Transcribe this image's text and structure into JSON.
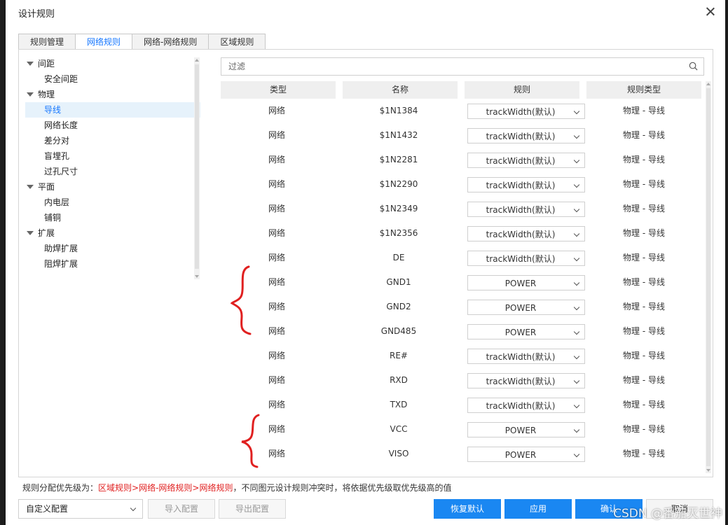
{
  "window": {
    "title": "设计规则"
  },
  "tabs": [
    {
      "label": "规则管理",
      "active": false
    },
    {
      "label": "网络规则",
      "active": true
    },
    {
      "label": "网络-网络规则",
      "active": false
    },
    {
      "label": "区域规则",
      "active": false
    }
  ],
  "tree": [
    {
      "label": "间距",
      "level": 1,
      "expanded": true
    },
    {
      "label": "安全间距",
      "level": 2
    },
    {
      "label": "物理",
      "level": 1,
      "expanded": true
    },
    {
      "label": "导线",
      "level": 2,
      "selected": true
    },
    {
      "label": "网络长度",
      "level": 2
    },
    {
      "label": "差分对",
      "level": 2
    },
    {
      "label": "盲埋孔",
      "level": 2
    },
    {
      "label": "过孔尺寸",
      "level": 2
    },
    {
      "label": "平面",
      "level": 1,
      "expanded": true
    },
    {
      "label": "内电层",
      "level": 2
    },
    {
      "label": "铺铜",
      "level": 2
    },
    {
      "label": "扩展",
      "level": 1,
      "expanded": true
    },
    {
      "label": "助焊扩展",
      "level": 2
    },
    {
      "label": "阻焊扩展",
      "level": 2
    }
  ],
  "filter": {
    "placeholder": "过滤"
  },
  "table": {
    "headers": [
      "类型",
      "名称",
      "规则",
      "规则类型"
    ],
    "rows": [
      {
        "type": "网络",
        "name": "$1N1384",
        "rule": "trackWidth(默认)",
        "rule_type": "物理 - 导线"
      },
      {
        "type": "网络",
        "name": "$1N1432",
        "rule": "trackWidth(默认)",
        "rule_type": "物理 - 导线"
      },
      {
        "type": "网络",
        "name": "$1N2281",
        "rule": "trackWidth(默认)",
        "rule_type": "物理 - 导线"
      },
      {
        "type": "网络",
        "name": "$1N2290",
        "rule": "trackWidth(默认)",
        "rule_type": "物理 - 导线"
      },
      {
        "type": "网络",
        "name": "$1N2349",
        "rule": "trackWidth(默认)",
        "rule_type": "物理 - 导线"
      },
      {
        "type": "网络",
        "name": "$1N2356",
        "rule": "trackWidth(默认)",
        "rule_type": "物理 - 导线"
      },
      {
        "type": "网络",
        "name": "DE",
        "rule": "trackWidth(默认)",
        "rule_type": "物理 - 导线"
      },
      {
        "type": "网络",
        "name": "GND1",
        "rule": "POWER",
        "rule_type": "物理 - 导线"
      },
      {
        "type": "网络",
        "name": "GND2",
        "rule": "POWER",
        "rule_type": "物理 - 导线"
      },
      {
        "type": "网络",
        "name": "GND485",
        "rule": "POWER",
        "rule_type": "物理 - 导线"
      },
      {
        "type": "网络",
        "name": "RE#",
        "rule": "trackWidth(默认)",
        "rule_type": "物理 - 导线"
      },
      {
        "type": "网络",
        "name": "RXD",
        "rule": "trackWidth(默认)",
        "rule_type": "物理 - 导线"
      },
      {
        "type": "网络",
        "name": "TXD",
        "rule": "trackWidth(默认)",
        "rule_type": "物理 - 导线"
      },
      {
        "type": "网络",
        "name": "VCC",
        "rule": "POWER",
        "rule_type": "物理 - 导线"
      },
      {
        "type": "网络",
        "name": "VISO",
        "rule": "POWER",
        "rule_type": "物理 - 导线"
      }
    ]
  },
  "note": {
    "prefix": "规则分配优先级为：",
    "priority": "区域规则>网络-网络规则>网络规则",
    "suffix": "，不同图元设计规则冲突时，将依据优先级取优先级高的值"
  },
  "footer": {
    "config_select": "自定义配置",
    "import_label": "导入配置",
    "export_label": "导出配置",
    "restore_label": "恢复默认",
    "apply_label": "应用",
    "ok_label": "确认",
    "cancel_label": "取消"
  },
  "watermark": "CSDN @番茄灭世神",
  "colors": {
    "accent": "#1a87f2",
    "annotation": "#e02020",
    "selected_bg": "#e6f2fb"
  }
}
